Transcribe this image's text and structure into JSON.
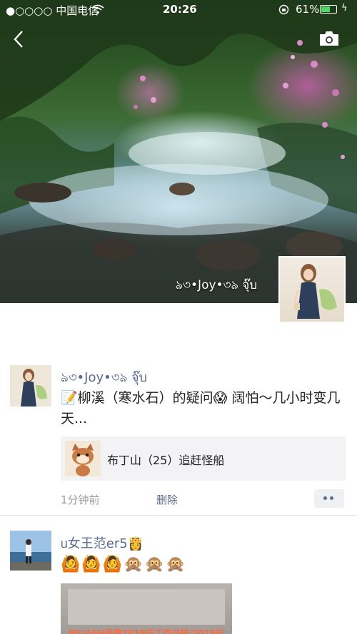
{
  "status_bar": {
    "carrier": "●○○○○ 中国电信",
    "time": "20:26",
    "battery": "61%",
    "battery_level": 0.61
  },
  "cover": {
    "name": "ঌ৩•Joy•৩ঌ จุ๊บ"
  },
  "posts": [
    {
      "nickname": "ঌ৩•Joy•৩ঌ จุ๊บ",
      "text": "📝柳溪（寒水石）的疑问😱 阔怕～几小时变几天...",
      "link_title": "布丁山（25）追赶怪船",
      "time": "1分钟前",
      "delete_label": "删除"
    },
    {
      "nickname": "ᥙ女王范er5👸",
      "emojis": "🙆🙆🙆🙊🙊🙊",
      "image_caption": "NS/ASH品牌2018年工作总结/2019年"
    }
  ],
  "icons": {
    "back": "chevron-left-icon",
    "camera": "camera-icon",
    "wifi": "wifi-icon",
    "battery": "battery-icon",
    "more": "more-dots-icon"
  },
  "colors": {
    "nickname": "#5b6a92",
    "battery_fill": "#4cd964"
  }
}
